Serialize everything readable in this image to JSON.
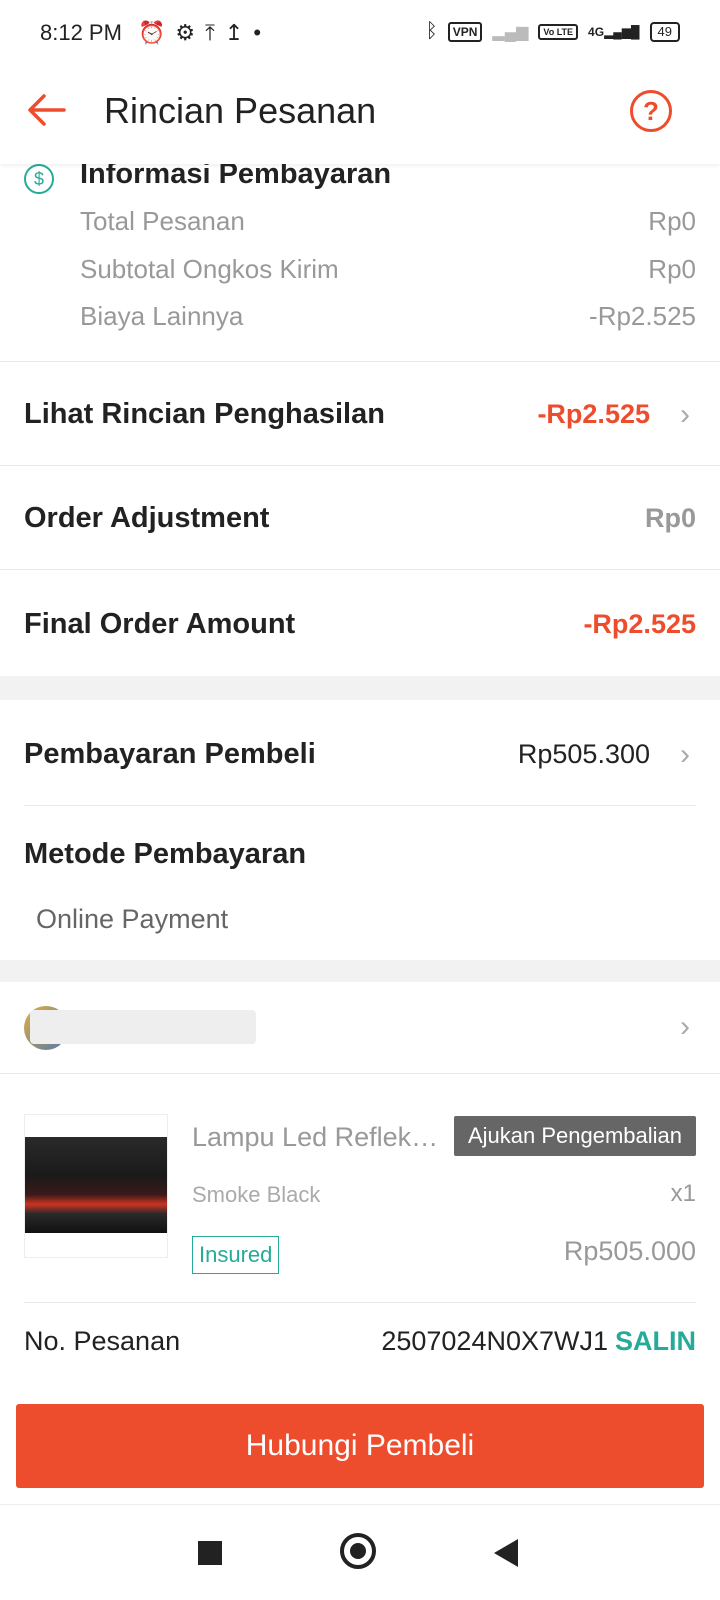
{
  "status_bar": {
    "time": "8:12 PM",
    "vpn": "VPN",
    "volte": "Vo LTE",
    "network": "4G",
    "battery": "49"
  },
  "header": {
    "title": "Rincian Pesanan",
    "back_icon": "arrow-left-icon",
    "help_icon": "question-circle-icon",
    "help_glyph": "?"
  },
  "payment_info": {
    "heading": "Informasi Pembayaran",
    "icon": "dollar-circle-icon",
    "icon_glyph": "$",
    "rows": [
      {
        "label": "Total Pesanan",
        "value": "Rp0"
      },
      {
        "label": "Subtotal Ongkos Kirim",
        "value": "Rp0"
      },
      {
        "label": "Biaya Lainnya",
        "value": "-Rp2.525"
      }
    ]
  },
  "income_details": {
    "label": "Lihat Rincian Penghasilan",
    "value": "-Rp2.525"
  },
  "order_adjustment": {
    "label": "Order Adjustment",
    "value": "Rp0"
  },
  "final_amount": {
    "label": "Final Order Amount",
    "value": "-Rp2.525"
  },
  "buyer_payment": {
    "label": "Pembayaran Pembeli",
    "value": "Rp505.300"
  },
  "payment_method": {
    "label": "Metode Pembayaran",
    "value": "Online Payment"
  },
  "product": {
    "name": "Lampu Led Reflek…",
    "return_button": "Ajukan Pengembalian",
    "variant": "Smoke Black",
    "quantity": "x1",
    "insured_badge": "Insured",
    "price": "Rp505.000"
  },
  "order_number": {
    "label": "No. Pesanan",
    "value": "2507024N0X7WJ1",
    "copy_label": "SALIN"
  },
  "cta": {
    "label": "Hubungi Pembeli"
  },
  "colors": {
    "accent": "#ee4d2d",
    "teal": "#26aa99"
  }
}
